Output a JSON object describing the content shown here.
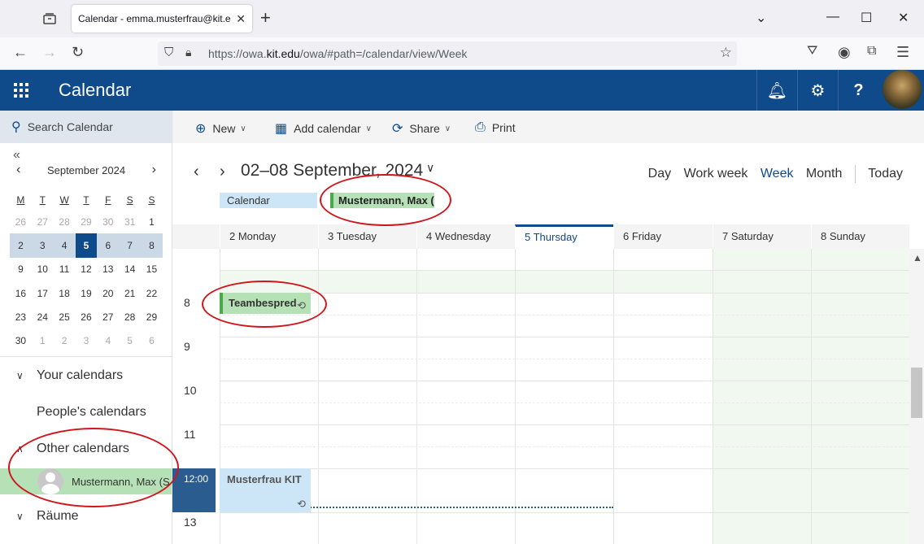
{
  "browser": {
    "tab_title": "Calendar - emma.musterfrau@kit.e",
    "url_prefix": "https://owa.",
    "url_domain": "kit.edu",
    "url_suffix": "/owa/#path=/calendar/view/Week"
  },
  "header": {
    "title": "Calendar"
  },
  "sidebar": {
    "search_placeholder": "Search Calendar",
    "mini_cal": {
      "month": "September 2024",
      "weekdays": [
        "M",
        "T",
        "W",
        "T",
        "F",
        "S",
        "S"
      ],
      "weeks": [
        [
          "26",
          "27",
          "28",
          "29",
          "30",
          "31",
          "1"
        ],
        [
          "2",
          "3",
          "4",
          "5",
          "6",
          "7",
          "8"
        ],
        [
          "9",
          "10",
          "11",
          "12",
          "13",
          "14",
          "15"
        ],
        [
          "16",
          "17",
          "18",
          "19",
          "20",
          "21",
          "22"
        ],
        [
          "23",
          "24",
          "25",
          "26",
          "27",
          "28",
          "29"
        ],
        [
          "30",
          "1",
          "2",
          "3",
          "4",
          "5",
          "6"
        ]
      ]
    },
    "your_calendars": "Your calendars",
    "peoples_calendars": "People's calendars",
    "other_calendars": "Other calendars",
    "other_item": "Mustermann, Max (S",
    "rooms": "Räume"
  },
  "toolbar": {
    "new": "New",
    "add_calendar": "Add calendar",
    "share": "Share",
    "print": "Print"
  },
  "main": {
    "range": "02–08 September, 2024",
    "views": {
      "day": "Day",
      "work_week": "Work week",
      "week": "Week",
      "month": "Month",
      "today": "Today"
    },
    "pill_calendar": "Calendar",
    "pill_max": "Mustermann, Max (S",
    "days": [
      "2 Monday",
      "3 Tuesday",
      "4 Wednesday",
      "5 Thursday",
      "6 Friday",
      "7 Saturday",
      "8 Sunday"
    ],
    "hours": [
      "8",
      "9",
      "10",
      "11",
      "13"
    ],
    "now": "12:00",
    "events": {
      "team": "Teambespred",
      "kit": "Musterfrau KIT"
    }
  }
}
